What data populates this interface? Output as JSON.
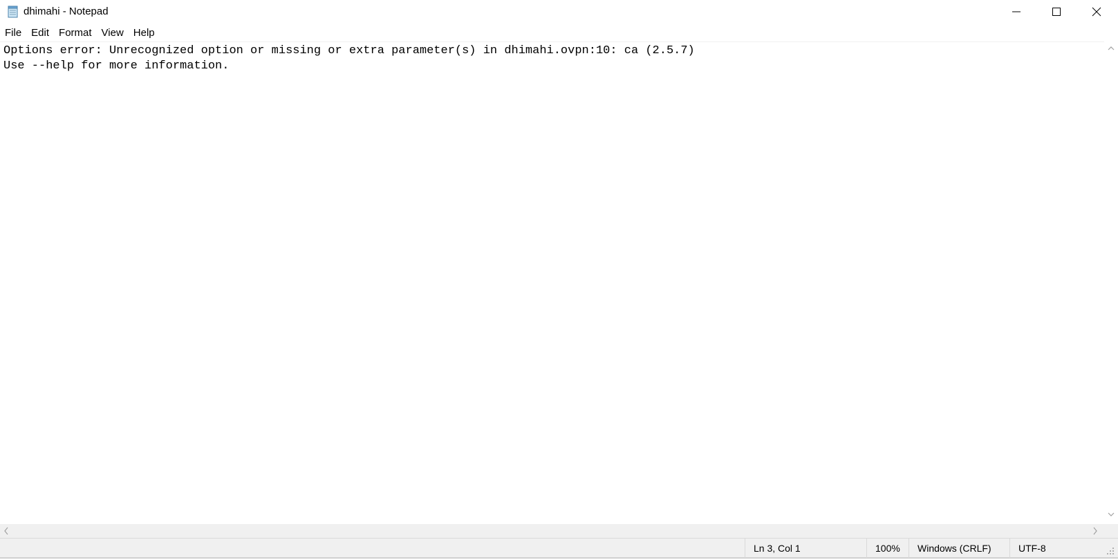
{
  "window": {
    "title": "dhimahi - Notepad",
    "icon": "notepad-icon"
  },
  "titlebar_buttons": {
    "minimize_icon": "minimize-icon",
    "maximize_icon": "maximize-icon",
    "close_icon": "close-icon"
  },
  "menu": {
    "items": [
      {
        "label": "File"
      },
      {
        "label": "Edit"
      },
      {
        "label": "Format"
      },
      {
        "label": "View"
      },
      {
        "label": "Help"
      }
    ]
  },
  "editor": {
    "lines": [
      "Options error: Unrecognized option or missing or extra parameter(s) in dhimahi.ovpn:10: ca (2.5.7)",
      "Use --help for more information."
    ]
  },
  "statusbar": {
    "position": "Ln 3, Col 1",
    "zoom": "100%",
    "line_ending": "Windows (CRLF)",
    "encoding": "UTF-8"
  },
  "colors": {
    "background": "#ffffff",
    "chrome": "#f0f0f0",
    "text": "#000000"
  }
}
